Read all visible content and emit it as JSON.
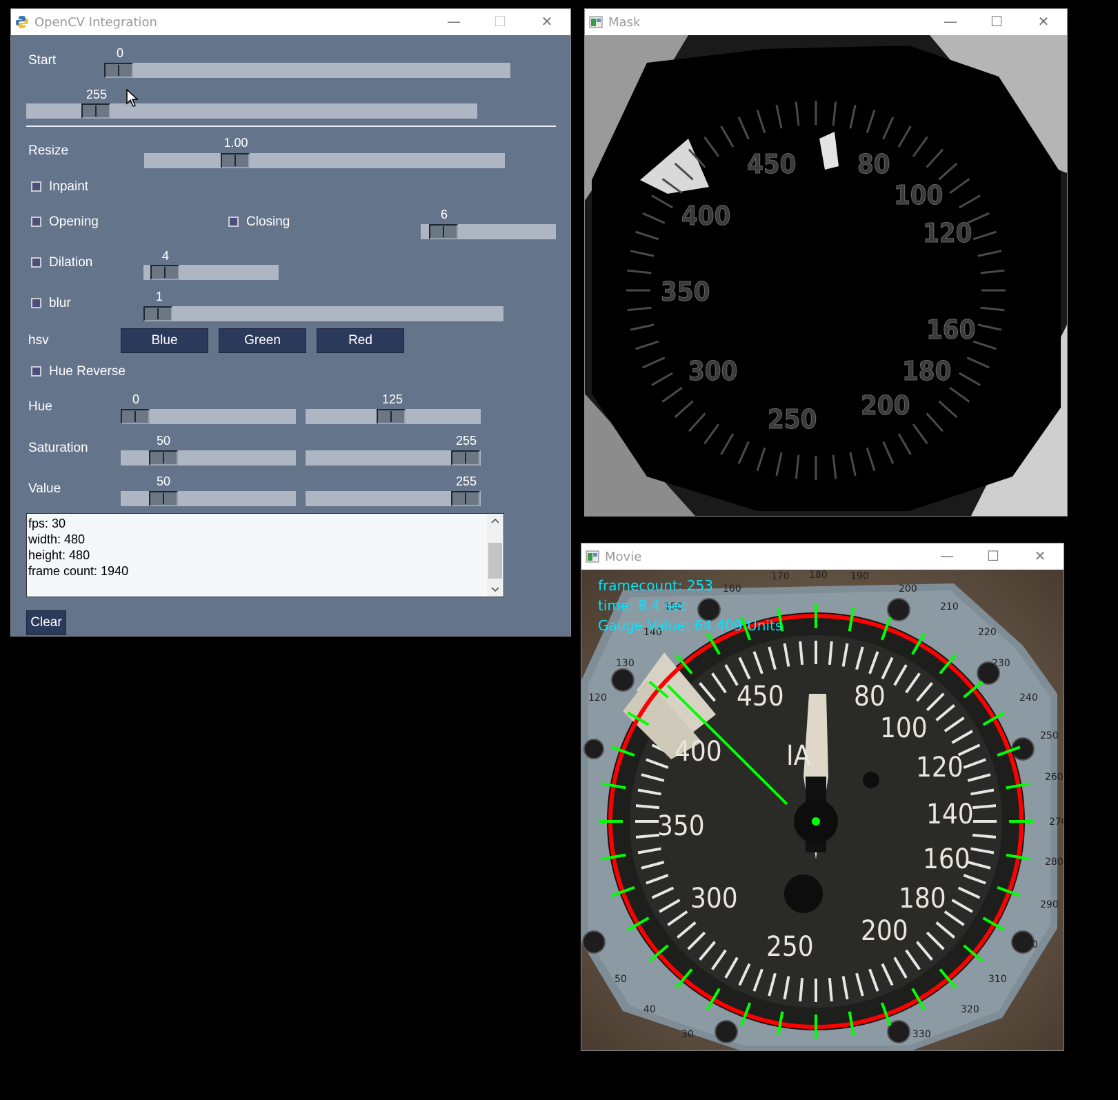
{
  "control_window": {
    "title": "OpenCV Integration",
    "minimize": "—",
    "maximize": "☐",
    "close": "✕",
    "start": {
      "label": "Start",
      "value1": "0",
      "value2": "255"
    },
    "resize": {
      "label": "Resize",
      "value": "1.00"
    },
    "inpaint": {
      "label": "Inpaint"
    },
    "opening": {
      "label": "Opening"
    },
    "closing": {
      "label": "Closing",
      "value": "6"
    },
    "dilation": {
      "label": "Dilation",
      "value": "4"
    },
    "blur": {
      "label": "blur",
      "value": "1"
    },
    "hsv": {
      "label": "hsv",
      "buttons": [
        "Blue",
        "Green",
        "Red"
      ]
    },
    "hue_reverse": {
      "label": "Hue Reverse"
    },
    "hue": {
      "label": "Hue",
      "low": "0",
      "high": "125"
    },
    "saturation": {
      "label": "Saturation",
      "low": "50",
      "high": "255"
    },
    "value": {
      "label": "Value",
      "low": "50",
      "high": "255"
    },
    "console_lines": [
      "fps: 30",
      "width: 480",
      "height: 480",
      "frame count: 1940"
    ],
    "clear_label": "Clear"
  },
  "mask_window": {
    "title": "Mask",
    "minimize": "—",
    "maximize": "☐",
    "close": "✕",
    "gauge_numbers": [
      "450",
      "80",
      "100",
      "400",
      "120",
      "350",
      "160",
      "300",
      "180",
      "250",
      "200"
    ]
  },
  "movie_window": {
    "title": "Movie",
    "minimize": "—",
    "maximize": "☐",
    "close": "✕",
    "overlay": {
      "framecount": "framecount: 253",
      "time": "time: 8.4 sec",
      "gauge_value": "Gauge Value: 64.409 Units"
    },
    "dial_numbers": [
      "450",
      "80",
      "100",
      "400",
      "IA",
      "120",
      "140",
      "350",
      "160",
      "300",
      "180",
      "200",
      "250"
    ],
    "bezel_numbers": [
      "170",
      "180",
      "190",
      "160",
      "150",
      "200",
      "210",
      "140",
      "220",
      "130",
      "230",
      "120",
      "240",
      "250",
      "260",
      "270",
      "280",
      "290",
      "60",
      "300",
      "50",
      "310",
      "40",
      "320",
      "30",
      "330"
    ],
    "colors": {
      "circle": "#ff0000",
      "ticks": "#00ff00",
      "overlay_text": "#00e5ff"
    }
  }
}
